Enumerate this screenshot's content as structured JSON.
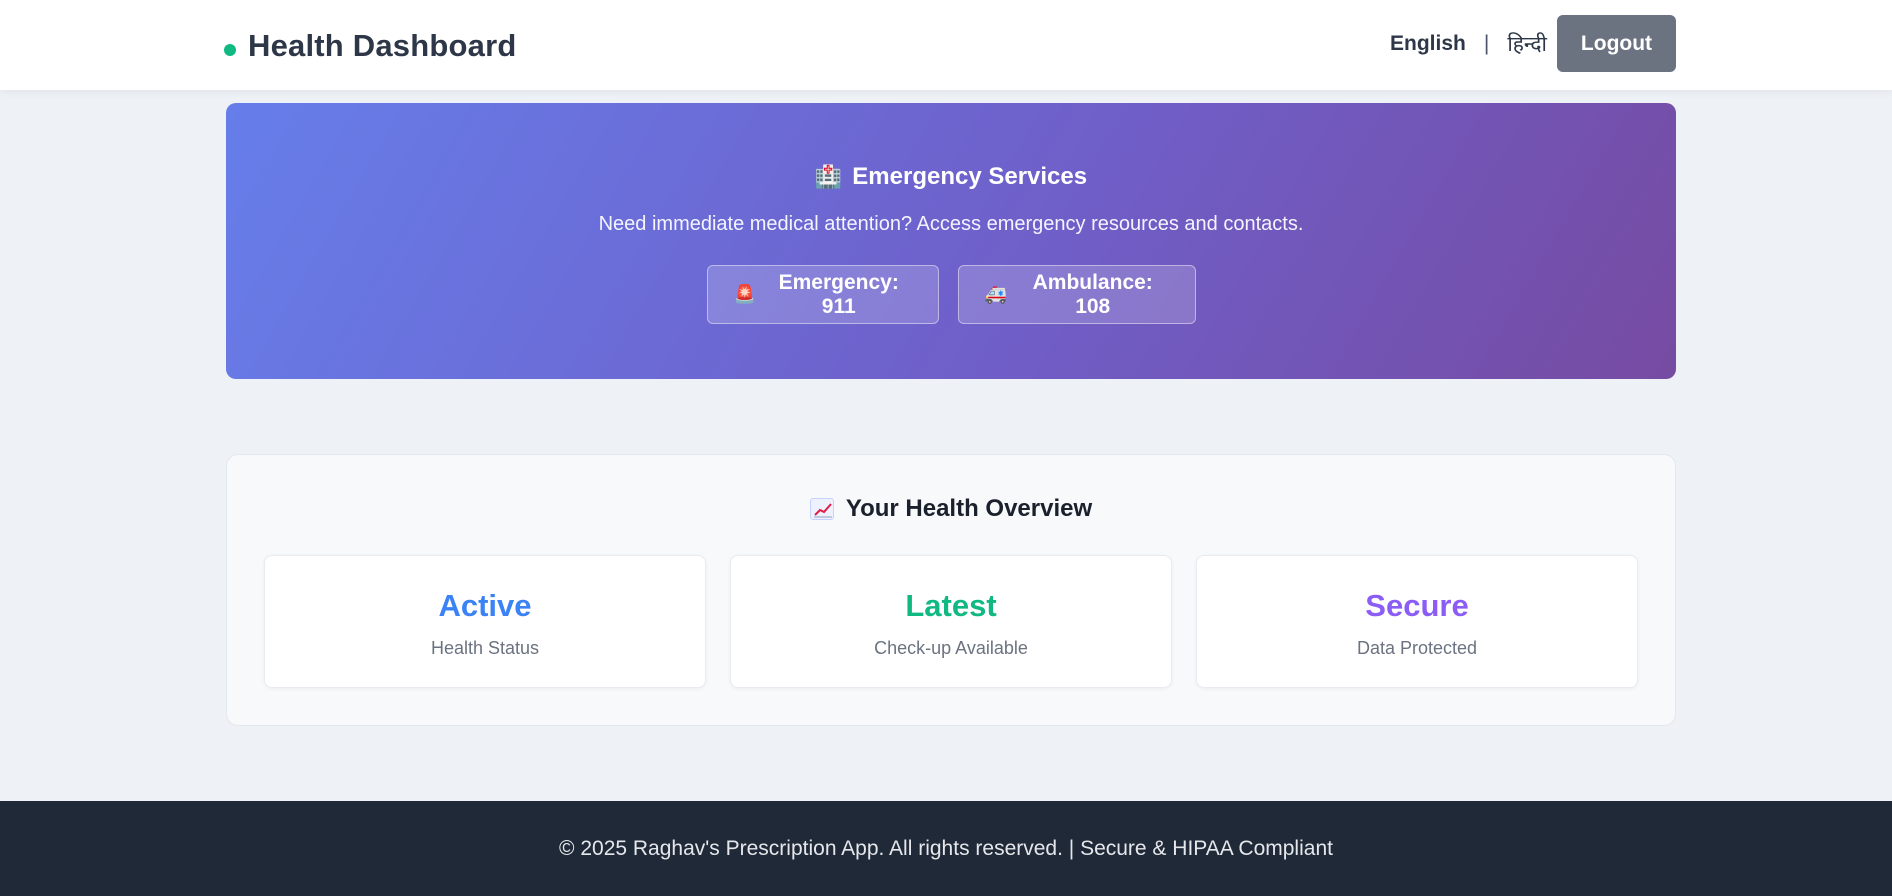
{
  "header": {
    "title": "Health Dashboard",
    "lang_english": "English",
    "lang_separator": "|",
    "lang_hindi": "हिन्दी",
    "logout_label": "Logout"
  },
  "emergency": {
    "icon": "🏥",
    "title": "Emergency Services",
    "description": "Need immediate medical attention? Access emergency resources and contacts.",
    "buttons": [
      {
        "icon": "🚨",
        "label": "Emergency: 911"
      },
      {
        "icon": "🚑",
        "label": "Ambulance: 108"
      }
    ]
  },
  "overview": {
    "icon": "chart-increasing-icon",
    "title": "Your Health Overview",
    "cards": [
      {
        "value": "Active",
        "label": "Health Status",
        "color": "#3b82f6"
      },
      {
        "value": "Latest",
        "label": "Check-up Available",
        "color": "#10b981"
      },
      {
        "value": "Secure",
        "label": "Data Protected",
        "color": "#8b5cf6"
      }
    ]
  },
  "footer": {
    "text": "© 2025 Raghav's Prescription App. All rights reserved. | Secure & HIPAA Compliant"
  },
  "colors": {
    "status_dot": "#10b981",
    "logout_bg": "#6b7280",
    "banner_gradient_start": "#667eea",
    "banner_gradient_end": "#764ba2",
    "footer_bg": "#1f2937"
  }
}
